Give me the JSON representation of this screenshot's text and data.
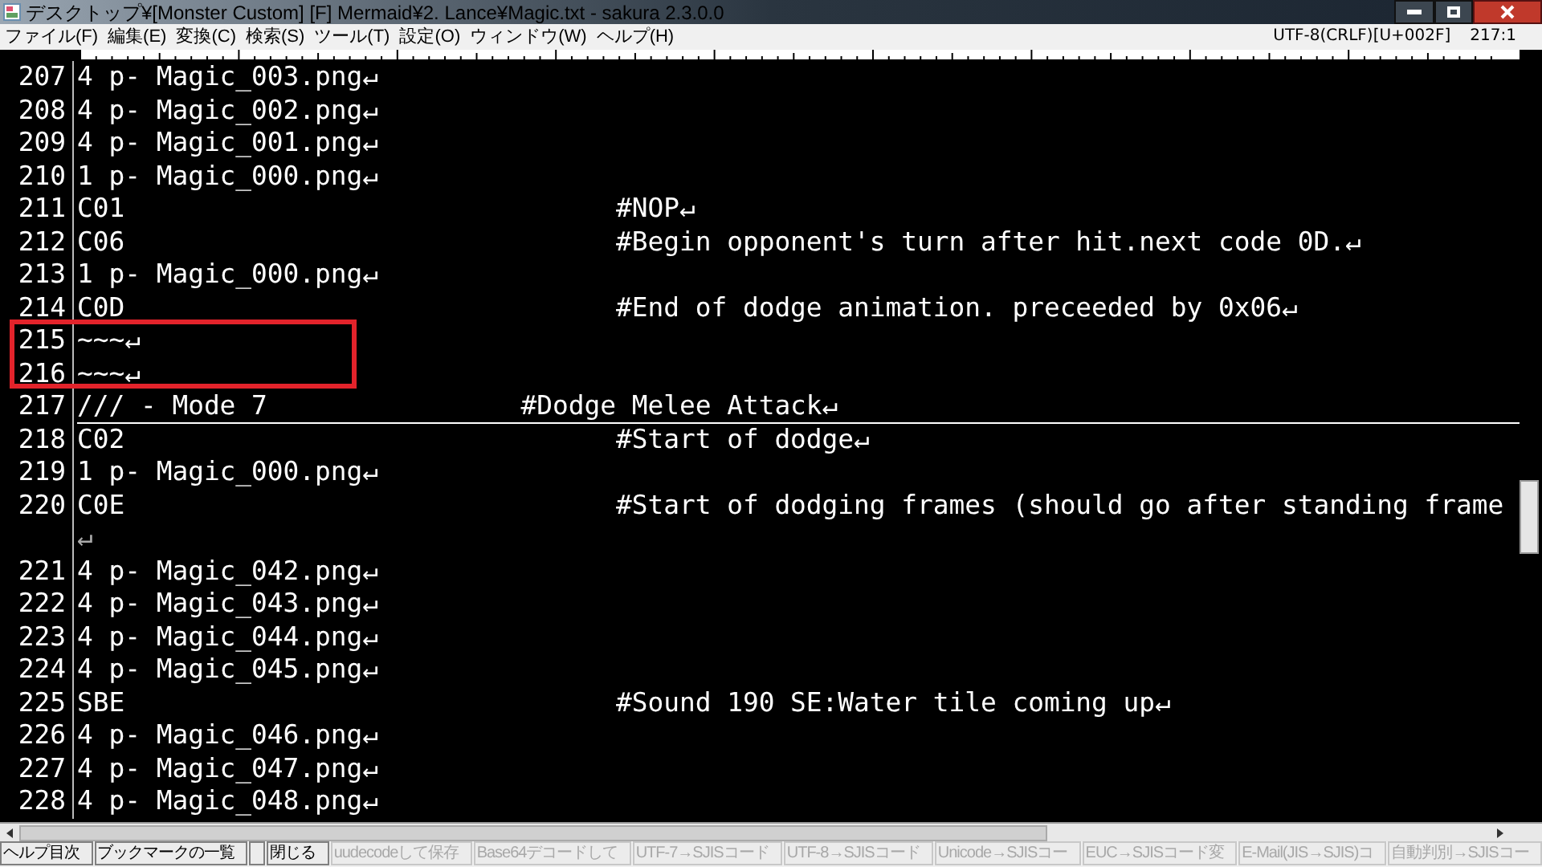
{
  "window": {
    "title": "デスクトップ¥[Monster Custom] [F] Mermaid¥2. Lance¥Magic.txt - sakura 2.3.0.0"
  },
  "menu": [
    "ファイル(F)",
    "編集(E)",
    "変換(C)",
    "検索(S)",
    "ツール(T)",
    "設定(O)",
    "ウィンドウ(W)",
    "ヘルプ(H)"
  ],
  "status": {
    "encoding": "UTF-8(CRLF)[U+002F]",
    "position": "217:1"
  },
  "lines": [
    {
      "number": "207",
      "text": "4 p- Magic_003.png↵",
      "current": false
    },
    {
      "number": "208",
      "text": "4 p- Magic_002.png↵",
      "current": false
    },
    {
      "number": "209",
      "text": "4 p- Magic_001.png↵",
      "current": false
    },
    {
      "number": "210",
      "text": "1 p- Magic_000.png↵",
      "current": false
    },
    {
      "number": "211",
      "text": "C01                               #NOP↵",
      "current": false
    },
    {
      "number": "212",
      "text": "C06                               #Begin opponent's turn after hit.next code 0D.↵",
      "current": false
    },
    {
      "number": "213",
      "text": "1 p- Magic_000.png↵",
      "current": false
    },
    {
      "number": "214",
      "text": "C0D                               #End of dodge animation. preceeded by 0x06↵",
      "current": false
    },
    {
      "number": "215",
      "text": "~~~↵",
      "current": false
    },
    {
      "number": "216",
      "text": "~~~↵",
      "current": false
    },
    {
      "number": "217",
      "text": "/// - Mode 7                #Dodge Melee Attack↵",
      "current": true
    },
    {
      "number": "218",
      "text": "C02                               #Start of dodge↵",
      "current": false
    },
    {
      "number": "219",
      "text": "1 p- Magic_000.png↵",
      "current": false
    },
    {
      "number": "220",
      "text": "C0E                               #Start of dodging frames (should go after standing frame",
      "wrap": "↵",
      "current": false
    },
    {
      "number": "221",
      "text": "4 p- Magic_042.png↵",
      "current": false
    },
    {
      "number": "222",
      "text": "4 p- Magic_043.png↵",
      "current": false
    },
    {
      "number": "223",
      "text": "4 p- Magic_044.png↵",
      "current": false
    },
    {
      "number": "224",
      "text": "4 p- Magic_045.png↵",
      "current": false
    },
    {
      "number": "225",
      "text": "SBE                               #Sound 190 SE:Water tile coming up↵",
      "current": false
    },
    {
      "number": "226",
      "text": "4 p- Magic_046.png↵",
      "current": false
    },
    {
      "number": "227",
      "text": "4 p- Magic_047.png↵",
      "current": false
    },
    {
      "number": "228",
      "text": "4 p- Magic_048.png↵",
      "current": false
    }
  ],
  "function_keys": [
    {
      "label": "ヘルプ目次",
      "disabled": false
    },
    {
      "label": "ブックマークの一覧",
      "disabled": false
    },
    {
      "disabled": false
    },
    {
      "label": "閉じる",
      "disabled": false
    },
    {
      "label": "uudecodeして保存",
      "disabled": true
    },
    {
      "label": "Base64デコードして",
      "disabled": true
    },
    {
      "label": "UTF-7→SJISコード",
      "disabled": true
    },
    {
      "label": "UTF-8→SJISコード",
      "disabled": true
    },
    {
      "label": "Unicode→SJISコー",
      "disabled": true
    },
    {
      "label": "EUC→SJISコード変",
      "disabled": true
    },
    {
      "label": "E-Mail(JIS→SJIS)コ",
      "disabled": true
    },
    {
      "label": "自動判別→SJISコー",
      "disabled": true
    }
  ]
}
